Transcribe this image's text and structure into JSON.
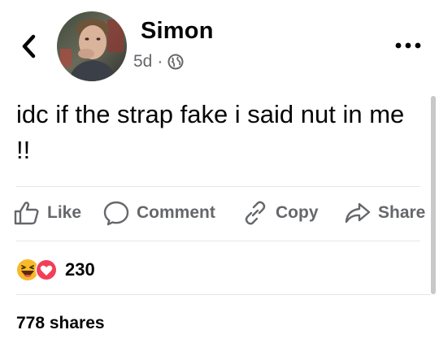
{
  "header": {
    "author_name": "Simon",
    "timestamp": "5d",
    "separator": "·",
    "audience_icon": "globe-icon",
    "back_icon": "chevron-left-icon",
    "more_icon": "more-horizontal-icon"
  },
  "post": {
    "text": "idc if the strap fake i said nut in me !!"
  },
  "actions": [
    {
      "label": "Like",
      "icon": "thumbs-up-icon"
    },
    {
      "label": "Comment",
      "icon": "comment-bubble-icon"
    },
    {
      "label": "Copy",
      "icon": "link-icon"
    },
    {
      "label": "Share",
      "icon": "share-arrow-icon"
    }
  ],
  "reactions": {
    "types": [
      "haha-emoji-icon",
      "love-heart-icon"
    ],
    "count": "230"
  },
  "shares": {
    "label": "778 shares"
  },
  "colors": {
    "text_primary": "#050505",
    "text_secondary": "#65676b",
    "divider": "#e4e6eb",
    "love_red": "#f33e58",
    "haha_yellow": "#f7b928"
  }
}
